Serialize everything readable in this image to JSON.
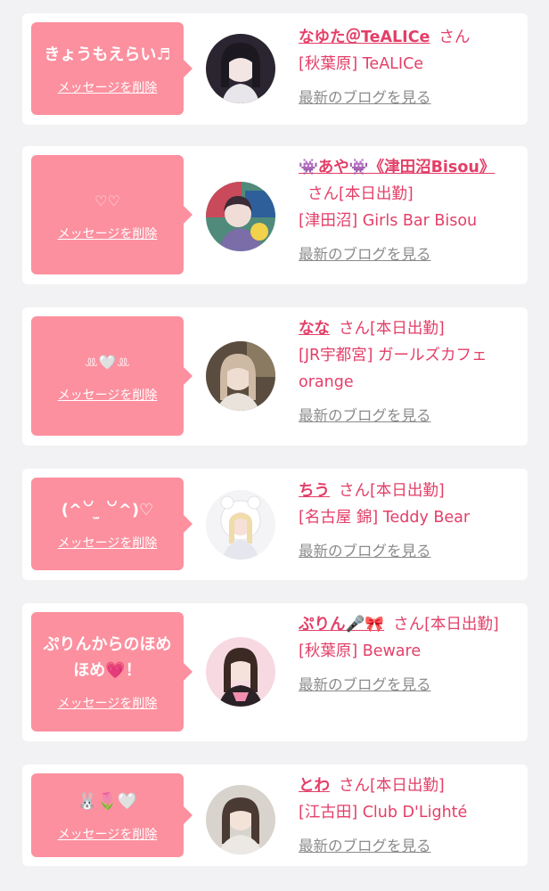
{
  "delete_label": "メッセージを削除",
  "blog_label": "最新のブログを見る",
  "honorific": "さん",
  "items": [
    {
      "message": "きょうもえらい♬",
      "name": "なゆた＠TeALICe",
      "status": "",
      "shop": "[秋葉原] TeALICe"
    },
    {
      "message": "♡♡",
      "name": "👾あや👾《津田沼Bisou》",
      "status": "[本日出勤]",
      "shop": "[津田沼] Girls Bar Bisou"
    },
    {
      "message": "ꔛ🤍ꔛ",
      "name": "なな",
      "status": "[本日出勤]",
      "shop": "[JR宇都宮] ガールズカフェ orange"
    },
    {
      "message": "(^꒡ ̫ ꒡^)♡",
      "name": "ちう",
      "status": "[本日出勤]",
      "shop": "[名古屋 錦] Teddy Bear"
    },
    {
      "message": "ぷりんからのほめほめ💗！",
      "name": "ぷりん🎤🎀",
      "status": "[本日出勤]",
      "shop": "[秋葉原] Beware"
    },
    {
      "message": "🐰🌷🤍",
      "name": "とわ",
      "status": "[本日出勤]",
      "shop": "[江古田] Club D'Lighté"
    }
  ]
}
